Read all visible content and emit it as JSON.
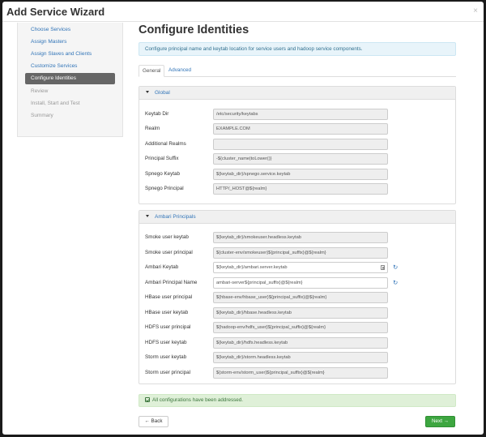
{
  "header": {
    "title": "Add Service Wizard",
    "close_label": "×"
  },
  "sidebar": {
    "items": [
      {
        "label": "Choose Services",
        "state": "done"
      },
      {
        "label": "Assign Masters",
        "state": "done"
      },
      {
        "label": "Assign Slaves and Clients",
        "state": "done"
      },
      {
        "label": "Customize Services",
        "state": "done"
      },
      {
        "label": "Configure Identities",
        "state": "active"
      },
      {
        "label": "Review",
        "state": "disabled"
      },
      {
        "label": "Install, Start and Test",
        "state": "disabled"
      },
      {
        "label": "Summary",
        "state": "disabled"
      }
    ]
  },
  "main": {
    "title": "Configure Identities",
    "info": "Configure principal name and keytab location for service users and hadoop service components.",
    "tabs": [
      {
        "label": "General",
        "active": true
      },
      {
        "label": "Advanced",
        "active": false
      }
    ],
    "panels": [
      {
        "title": "Global",
        "rows": [
          {
            "label": "Keytab Dir",
            "value": "/etc/security/keytabs",
            "editable": false
          },
          {
            "label": "Realm",
            "value": "EXAMPLE.COM",
            "editable": false
          },
          {
            "label": "Additional Realms",
            "value": "",
            "editable": false
          },
          {
            "label": "Principal Suffix",
            "value": "-${cluster_name|toLower()}",
            "editable": false
          },
          {
            "label": "Spnego Keytab",
            "value": "${keytab_dir}/spnego.service.keytab",
            "editable": false
          },
          {
            "label": "Spnego Principal",
            "value": "HTTP/_HOST@${realm}",
            "editable": false
          }
        ]
      },
      {
        "title": "Ambari Principals",
        "rows": [
          {
            "label": "Smoke user keytab",
            "value": "${keytab_dir}/smokeuser.headless.keytab",
            "editable": false
          },
          {
            "label": "Smoke user principal",
            "value": "${cluster-env/smokeuser}${principal_suffix}@${realm}",
            "editable": false
          },
          {
            "label": "Ambari Keytab",
            "value": "${keytab_dir}/ambari.server.keytab",
            "editable": true,
            "doc_icon": "document-icon",
            "refresh_icon": "refresh-icon"
          },
          {
            "label": "Ambari Principal Name",
            "value": "ambari-server${principal_suffix}@${realm}",
            "editable": true,
            "refresh_icon": "refresh-icon"
          },
          {
            "label": "HBase user principal",
            "value": "${hbase-env/hbase_user}${principal_suffix}@${realm}",
            "editable": false
          },
          {
            "label": "HBase user keytab",
            "value": "${keytab_dir}/hbase.headless.keytab",
            "editable": false
          },
          {
            "label": "HDFS user principal",
            "value": "${hadoop-env/hdfs_user}${principal_suffix}@${realm}",
            "editable": false
          },
          {
            "label": "HDFS user keytab",
            "value": "${keytab_dir}/hdfs.headless.keytab",
            "editable": false
          },
          {
            "label": "Storm user keytab",
            "value": "${keytab_dir}/storm.headless.keytab",
            "editable": false
          },
          {
            "label": "Storm user principal",
            "value": "${storm-env/storm_user}${principal_suffix}@${realm}",
            "editable": false
          }
        ]
      }
    ],
    "success": "All configurations have been addressed.",
    "back_label": "← Back",
    "next_label": "Next →",
    "refresh_glyph": "↻"
  },
  "colors": {
    "link": "#3275b8",
    "active_nav": "#666666",
    "next_button": "#3da640",
    "success_bg": "#dff0d8",
    "info_bg": "#e8f4fa"
  }
}
